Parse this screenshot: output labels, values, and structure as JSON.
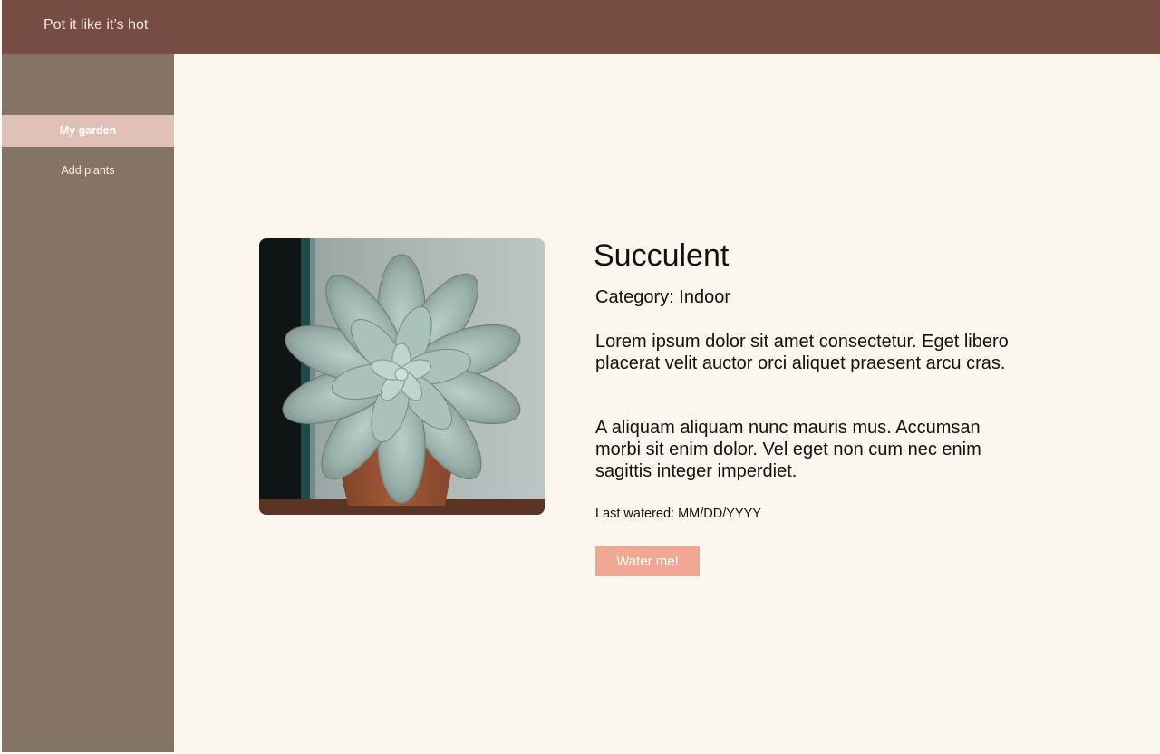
{
  "header": {
    "app_title": "Pot it like it’s hot"
  },
  "sidebar": {
    "items": [
      {
        "label": "My garden",
        "active": true
      },
      {
        "label": "Add plants",
        "active": false
      }
    ]
  },
  "plant": {
    "name": "Succulent",
    "category": "Category: Indoor",
    "description": [
      "Lorem ipsum dolor sit amet consectetur. Eget libero placerat velit auctor orci aliquet praesent arcu cras.",
      "A aliquam aliquam nunc mauris mus. Accumsan morbi sit enim dolor. Vel eget non cum nec enim sagittis integer imperdiet."
    ],
    "last_watered": "Last watered: MM/DD/YYYY",
    "photo_subject": "succulent-rosette-in-terracotta-pot"
  },
  "actions": {
    "water_label": "Water me!"
  },
  "colors": {
    "header_bg": "#774C42",
    "sidebar_bg": "#857464",
    "active_nav_bg": "#DFC0B9",
    "main_bg": "#FBF7EC",
    "button_bg": "#F0A793"
  }
}
